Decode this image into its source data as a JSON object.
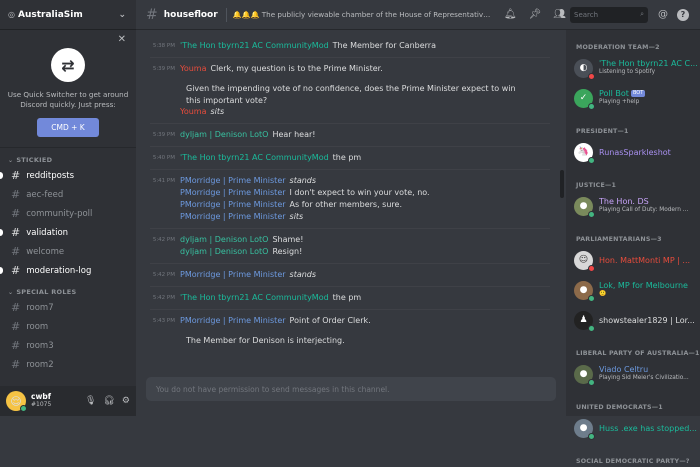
{
  "server": {
    "name": "AustraliaSim"
  },
  "switcher": {
    "hint": "Use Quick Switcher to get around Discord quickly. Just press:",
    "shortcut": "CMD + K"
  },
  "sidebar": {
    "categories": [
      {
        "name": "STICKIED",
        "channels": [
          {
            "name": "redditposts",
            "unread": true
          },
          {
            "name": "aec-feed",
            "unread": false
          },
          {
            "name": "community-poll",
            "unread": false
          },
          {
            "name": "validation",
            "unread": true
          },
          {
            "name": "welcome",
            "unread": false
          },
          {
            "name": "moderation-log",
            "unread": true
          }
        ]
      },
      {
        "name": "SPECIAL ROLES",
        "channels": [
          {
            "name": "room7",
            "unread": false
          },
          {
            "name": "room",
            "unread": false
          },
          {
            "name": "room3",
            "unread": false
          },
          {
            "name": "room2",
            "unread": false
          }
        ]
      }
    ]
  },
  "user": {
    "name": "cwbf",
    "discriminator": "#1075"
  },
  "channel": {
    "name": "housefloor",
    "topic": "🔔🔔🔔 The publicly viewable chamber of the House of Representatives, where members debate"
  },
  "messages": [
    {
      "time": "5:38 PM",
      "author": "'The Hon tbyrn21 AC CommunityMod",
      "color": "#1abc9c",
      "text": "The Member for Canberra",
      "italic": false
    },
    {
      "time": "5:39 PM",
      "author": "Youma",
      "color": "#e74c3c",
      "text": "Clerk, my question is to the Prime Minister.",
      "italic": false,
      "para": "Given the impending vote of no confidence, does the Prime Minister expect to win this important vote?",
      "follow": {
        "author": "Youma",
        "text": "sits",
        "italic": true
      }
    },
    {
      "time": "5:39 PM",
      "author": "dyljam | Denison LotO",
      "color": "#38c1a0",
      "text": "Hear hear!",
      "italic": false
    },
    {
      "time": "5:40 PM",
      "author": "'The Hon tbyrn21 AC CommunityMod",
      "color": "#1abc9c",
      "text": "the pm",
      "italic": false
    },
    {
      "time": "5:41 PM",
      "author": "PMorridge | Prime Minister",
      "color": "#6d9ae0",
      "text": "stands",
      "italic": true,
      "extra": [
        {
          "text": "I don't expect to win your vote, no.",
          "italic": false
        },
        {
          "text": "As for other members, sure.",
          "italic": false
        },
        {
          "text": "sits",
          "italic": true
        }
      ]
    },
    {
      "time": "5:42 PM",
      "author": "dyljam | Denison LotO",
      "color": "#38c1a0",
      "text": "Shame!",
      "italic": false,
      "extra": [
        {
          "text": "Resign!",
          "italic": false
        }
      ]
    },
    {
      "time": "5:42 PM",
      "author": "PMorridge | Prime Minister",
      "color": "#6d9ae0",
      "text": "stands",
      "italic": true
    },
    {
      "time": "5:42 PM",
      "author": "'The Hon tbyrn21 AC CommunityMod",
      "color": "#1abc9c",
      "text": "the pm",
      "italic": false
    },
    {
      "time": "5:43 PM",
      "author": "PMorridge | Prime Minister",
      "color": "#6d9ae0",
      "text": "Point of Order Clerk.",
      "italic": false,
      "para": "The Member for Denison is interjecting."
    }
  ],
  "input": {
    "placeholder": "You do not have permission to send messages in this channel."
  },
  "search": {
    "placeholder": "Search"
  },
  "members": [
    {
      "group": "MODERATION TEAM—2",
      "items": [
        {
          "name": "'The Hon tbyrn21 AC C...",
          "color": "#1abc9c",
          "activity": "Listening to Spotify",
          "avatar": "#4a4f57",
          "glyph": "◐",
          "status": "dnd"
        },
        {
          "name": "Poll Bot",
          "color": "#1abc9c",
          "activity": "Playing +help",
          "avatar": "#3ba55c",
          "glyph": "✓",
          "status": "online",
          "bot": "BOT"
        }
      ]
    },
    {
      "group": "PRESIDENT—1",
      "items": [
        {
          "name": "RunasSparkleshot",
          "color": "#a990f0",
          "activity": "",
          "avatar": "#ffffff",
          "glyph": "🦄",
          "status": "online"
        }
      ]
    },
    {
      "group": "JUSTICE—1",
      "items": [
        {
          "name": "The Hon. DS",
          "color": "#c6a2f7",
          "activity": "Playing Call of Duty: Modern ...",
          "avatar": "#7a8a5c",
          "glyph": "●",
          "status": "online"
        }
      ]
    },
    {
      "group": "PARLIAMENTARIANS—3",
      "items": [
        {
          "name": "Hon. MattMonti MP | ...",
          "color": "#e74c3c",
          "activity": "",
          "avatar": "#d8d8d8",
          "glyph": "☺",
          "status": "dnd"
        },
        {
          "name": "Lok, MP for Melbourne",
          "color": "#1abc9c",
          "activity": "🙂",
          "avatar": "#8c6a4a",
          "glyph": "●",
          "status": "online"
        },
        {
          "name": "showstealer1829 | Lor...",
          "color": "#dcddde",
          "activity": "",
          "avatar": "#222222",
          "glyph": "♟",
          "status": "online"
        }
      ]
    },
    {
      "group": "LIBERAL PARTY OF AUSTRALIA—1",
      "items": [
        {
          "name": "Viado Celtru",
          "color": "#6d9ae0",
          "activity": "Playing Sid Meier's Civilizatio...",
          "avatar": "#5a6a4a",
          "glyph": "●",
          "status": "online"
        }
      ]
    },
    {
      "group": "UNITED DEMOCRATS—1",
      "items": [
        {
          "name": "Huss .exe has stopped...",
          "color": "#1abc9c",
          "activity": "",
          "avatar": "#6e7d8c",
          "glyph": "●",
          "status": "online"
        }
      ]
    },
    {
      "group": "SOCIAL DEMOCRATIC PARTY—?",
      "items": []
    }
  ]
}
